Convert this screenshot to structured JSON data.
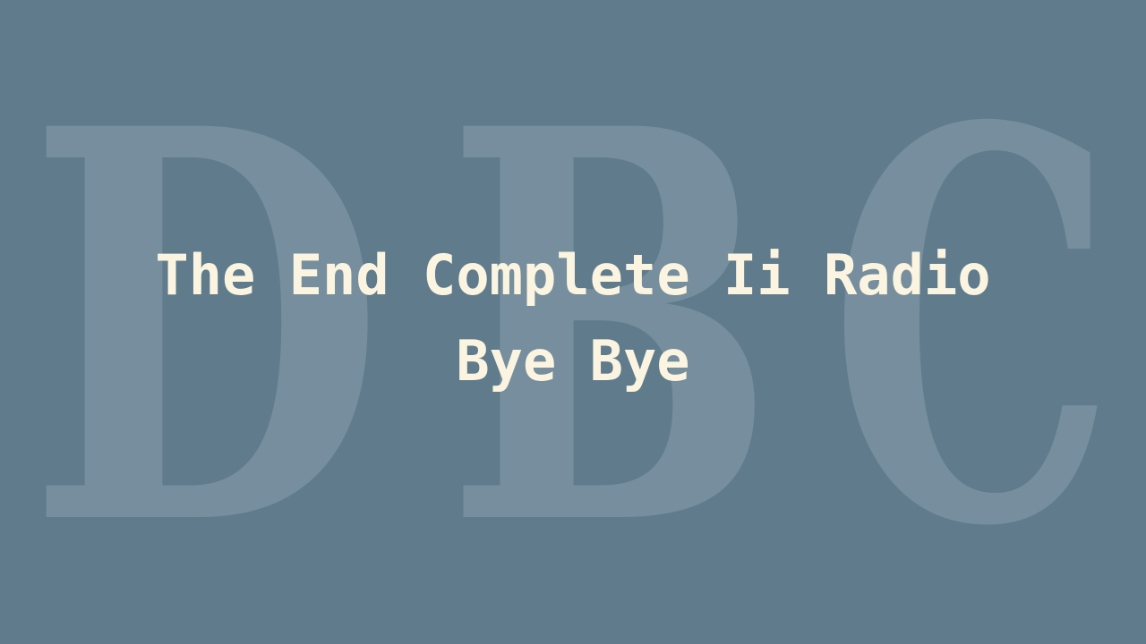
{
  "watermark": {
    "letters": [
      "D",
      "B",
      "C"
    ]
  },
  "title": {
    "line1": "The End Complete Ii Radio",
    "line2": "Bye Bye"
  },
  "colors": {
    "background": "#5f7b8c",
    "title_text": "#fbf4e0",
    "watermark": "#ffffff"
  }
}
